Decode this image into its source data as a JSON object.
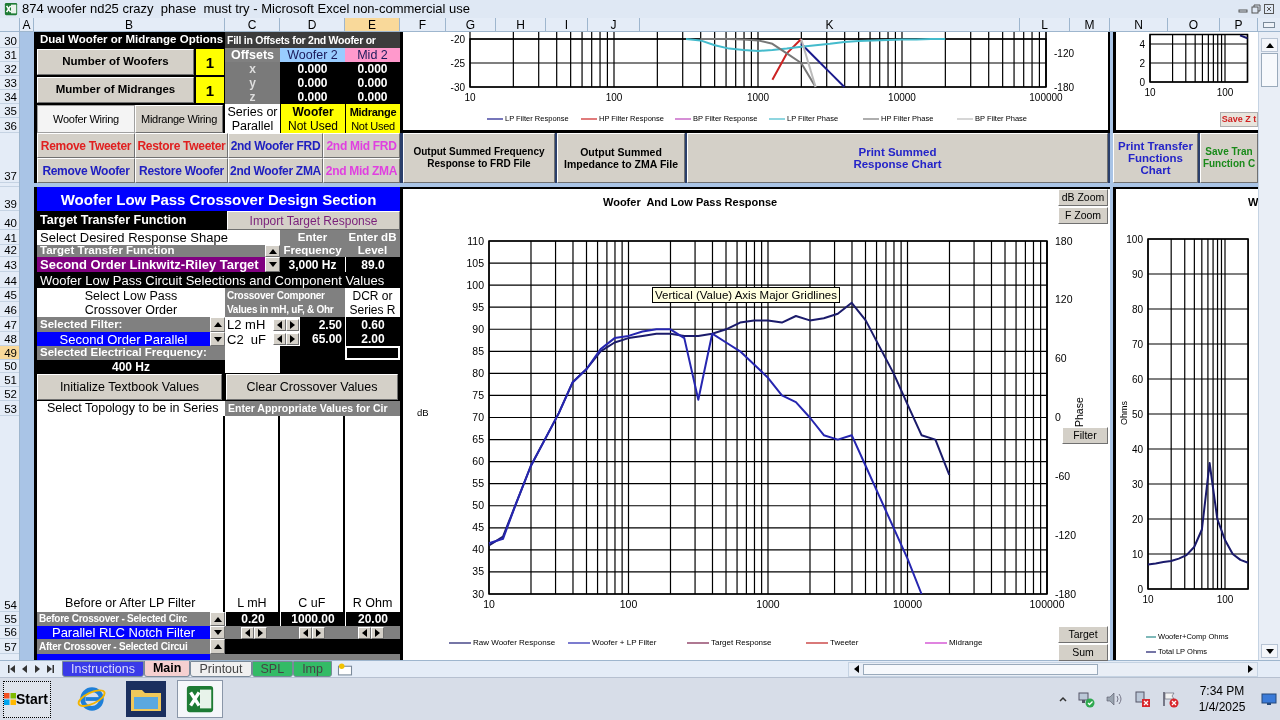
{
  "window": {
    "title": "874 woofer nd25 crazy  phase  must try - Microsoft Excel non-commercial use"
  },
  "column_headers": [
    {
      "label": "A",
      "selected": false
    },
    {
      "label": "B",
      "selected": false
    },
    {
      "label": "C",
      "selected": false
    },
    {
      "label": "D",
      "selected": false
    },
    {
      "label": "E",
      "selected": true
    },
    {
      "label": "F",
      "selected": false
    },
    {
      "label": "G",
      "selected": false
    },
    {
      "label": "H",
      "selected": false
    },
    {
      "label": "I",
      "selected": false
    },
    {
      "label": "J",
      "selected": false
    },
    {
      "label": "K",
      "selected": false
    },
    {
      "label": "L",
      "selected": false
    },
    {
      "label": "M",
      "selected": false
    },
    {
      "label": "N",
      "selected": false
    },
    {
      "label": "O",
      "selected": false
    },
    {
      "label": "P",
      "selected": false
    }
  ],
  "row_headers": [
    {
      "label": "30",
      "selected": false
    },
    {
      "label": "31",
      "selected": false
    },
    {
      "label": "32",
      "selected": false
    },
    {
      "label": "33",
      "selected": false
    },
    {
      "label": "34",
      "selected": false
    },
    {
      "label": "35",
      "selected": false
    },
    {
      "label": "36",
      "selected": false
    },
    {
      "label": "37",
      "selected": false
    },
    {
      "label": "39",
      "selected": false
    },
    {
      "label": "40",
      "selected": false
    },
    {
      "label": "41",
      "selected": false
    },
    {
      "label": "42",
      "selected": false
    },
    {
      "label": "43",
      "selected": false
    },
    {
      "label": "44",
      "selected": false
    },
    {
      "label": "45",
      "selected": false
    },
    {
      "label": "46",
      "selected": false
    },
    {
      "label": "47",
      "selected": false
    },
    {
      "label": "48",
      "selected": false
    },
    {
      "label": "49",
      "selected": true
    },
    {
      "label": "50",
      "selected": false
    },
    {
      "label": "51",
      "selected": false
    },
    {
      "label": "52",
      "selected": false
    },
    {
      "label": "53",
      "selected": false
    },
    {
      "label": "54",
      "selected": false
    },
    {
      "label": "55",
      "selected": false
    },
    {
      "label": "56",
      "selected": false
    },
    {
      "label": "57",
      "selected": false
    }
  ],
  "dual_options": {
    "title": "Dual Woofer or Midrange Options",
    "woofer_button": "Number of Woofers",
    "woofer_count": "1",
    "midrange_button": "Mumber of Midranges",
    "midrange_count": "1",
    "wiring_tabs": [
      {
        "label": "Woofer Wiring",
        "selected": true
      },
      {
        "label": "Midrange Wiring",
        "selected": false
      }
    ]
  },
  "offsets": {
    "title": "Fill in Offsets for 2nd Woofer or",
    "headers": [
      "Offsets",
      "Woofer 2",
      "Mid 2"
    ],
    "rows": [
      {
        "axis": "x",
        "woofer_2": "0.000",
        "mid_2": "0.000"
      },
      {
        "axis": "y",
        "woofer_2": "0.000",
        "mid_2": "0.000"
      },
      {
        "axis": "z",
        "woofer_2": "0.000",
        "mid_2": "0.000"
      }
    ],
    "wiring_label": [
      "Series or",
      "Parallel"
    ],
    "woofer_wiring": [
      "Woofer",
      "Not Used"
    ],
    "midrange_wiring": [
      "Midrange",
      "Not Used"
    ]
  },
  "tool_buttons": [
    {
      "label": "Remove Tweeter",
      "color": "#e02020"
    },
    {
      "label": "Restore Tweeter",
      "color": "#e02020"
    },
    {
      "label": "2nd Woofer FRD",
      "color": "#2020c0"
    },
    {
      "label": "2nd Mid FRD",
      "color": "#e040e0"
    },
    {
      "label": "Remove Woofer",
      "color": "#2020c0"
    },
    {
      "label": "Restore Woofer",
      "color": "#2020c0"
    },
    {
      "label": "2nd Woofer ZMA",
      "color": "#2020c0"
    },
    {
      "label": "2nd Mid ZMA",
      "color": "#e040e0"
    }
  ],
  "crossover": {
    "title": "Woofer Low Pass Crossover Design Section",
    "target_label": "Target Transfer Function",
    "import_button": "Import Target Response",
    "shape_label": "Select Desired Response Shape",
    "frequency_header": [
      "Enter",
      "Frequency"
    ],
    "level_header": [
      "Enter dB",
      "Level"
    ],
    "function_label": "Target Transfer Function",
    "function_value": "Second Order Linkwitz-Riley Target",
    "target_frequency": "3,000 Hz",
    "target_level": "89.0",
    "circuit_title": "Woofer Low Pass Circuit Selections and Component Values",
    "order_header": [
      "Select Low Pass",
      "Crossover Order"
    ],
    "component_header": [
      "Crossover Componer",
      "Values in mH, uF, & Ohr"
    ],
    "dcr_header": [
      "DCR or",
      "Series R"
    ],
    "filter_label": "Selected Filter:",
    "filter_value": "Second Order Parallel",
    "components": [
      {
        "name": "L2 mH",
        "value": "2.50",
        "dcr": "0.60"
      },
      {
        "name": "C2  uF",
        "value": "65.00",
        "dcr": "2.00"
      }
    ],
    "frequency_label": "Selected Electrical Frequency:",
    "frequency_value": "400 Hz",
    "buttons": [
      "Initialize Textbook Values",
      "Clear Crossover Values"
    ]
  },
  "topology": {
    "title": "Select Topology to be in Series",
    "values_title": "Enter Appropriate Values for Cir",
    "columns": [
      "Before or After LP Filter",
      "L mH",
      "C uF",
      "R Ohm"
    ],
    "before_label": "Before Crossover - Selected Circ",
    "before_value": "Parallel RLC Notch Filter",
    "before_values": [
      "0.20",
      "1000.00",
      "20.00"
    ],
    "after_label": "After Crossover - Selected Circui"
  },
  "top_chart": {
    "chart_data": {
      "type": "line",
      "grid": true,
      "legend": "bottom",
      "ylim": [
        -30,
        -20
      ],
      "yticks": [
        -30,
        -25,
        -20
      ],
      "y2lim": [
        -180,
        -93
      ],
      "y2ticks": [
        -180,
        -120
      ],
      "categories": [
        "10",
        null,
        null,
        null,
        null,
        null,
        null,
        null,
        null,
        null,
        "100",
        null,
        null,
        null,
        null,
        null,
        null,
        null,
        null,
        null,
        "1000",
        null,
        null,
        null,
        null,
        null,
        null,
        null,
        null,
        null,
        "10000",
        null,
        null,
        null,
        null,
        null,
        null,
        null,
        null,
        null,
        "100000"
      ],
      "series": [
        {
          "name": "LP Filter Response",
          "color": "#1a1a8c",
          "values": [
            null,
            null,
            null,
            null,
            null,
            null,
            null,
            null,
            null,
            null,
            null,
            null,
            null,
            null,
            null,
            null,
            null,
            null,
            null,
            null,
            null,
            null,
            null,
            -21,
            -24,
            -27,
            -30,
            null,
            null,
            null,
            null,
            null,
            null,
            null,
            null,
            null,
            null,
            null,
            null,
            null,
            null
          ]
        },
        {
          "name": "HP Filter Response",
          "color": "#cc2222",
          "values": [
            null,
            null,
            null,
            null,
            null,
            null,
            null,
            null,
            null,
            null,
            null,
            null,
            null,
            null,
            null,
            null,
            null,
            null,
            null,
            null,
            null,
            -28.5,
            -23,
            -20,
            null,
            null,
            null,
            null,
            null,
            null,
            null,
            null,
            null,
            null,
            null,
            null,
            null,
            null,
            null,
            null,
            null
          ]
        },
        {
          "name": "BP Filter Response",
          "color": "#bb44bb",
          "values": [
            null,
            null,
            null,
            null,
            null,
            null,
            null,
            null,
            null,
            null,
            null,
            null,
            null,
            null,
            null,
            null,
            null,
            null,
            null,
            null,
            null,
            null,
            null,
            null,
            null,
            null,
            null,
            null,
            null,
            null,
            null,
            null,
            null,
            null,
            null,
            null,
            null,
            null,
            null,
            null,
            null
          ]
        },
        {
          "name": "LP Filter Phase",
          "color": "#44bbcc",
          "values": [
            null,
            null,
            null,
            null,
            null,
            null,
            null,
            null,
            null,
            null,
            null,
            null,
            null,
            null,
            null,
            -20,
            -20.3,
            -21.3,
            -22,
            -22.3,
            -22.5,
            -22.3,
            -22,
            -21.6,
            -21.3,
            -21,
            -20.6,
            -20.4,
            -20.3,
            -20.2,
            -20.1,
            -20.1,
            -20,
            -20,
            null,
            null,
            null,
            null,
            null,
            null,
            null
          ]
        },
        {
          "name": "HP Filter Phase",
          "color": "#777777",
          "values": [
            null,
            null,
            null,
            null,
            null,
            null,
            null,
            null,
            null,
            null,
            null,
            null,
            null,
            null,
            null,
            null,
            -20,
            -20,
            -20,
            -20.1,
            -20.3,
            -21,
            -23,
            -25,
            -30,
            null,
            null,
            null,
            null,
            null,
            null,
            null,
            null,
            null,
            null,
            null,
            null,
            null,
            null,
            null,
            null
          ]
        },
        {
          "name": "BP Filter Phase",
          "color": "#bbbbbb",
          "values": [
            null,
            null,
            null,
            null,
            null,
            null,
            null,
            null,
            null,
            null,
            null,
            null,
            null,
            null,
            null,
            null,
            null,
            null,
            null,
            null,
            null,
            null,
            null,
            -20,
            -30,
            null,
            null,
            null,
            null,
            null,
            null,
            null,
            null,
            null,
            null,
            null,
            null,
            null,
            null,
            null,
            null
          ]
        }
      ]
    }
  },
  "summary_buttons": [
    {
      "label": "Output Summed Frequency Response to FRD File",
      "color": "#000000"
    },
    {
      "label": "Output Summed Impedance to ZMA File",
      "color": "#000000"
    },
    {
      "label": "Print Summed Response Chart",
      "color": "#2424c8"
    }
  ],
  "main_chart": {
    "chart_data": {
      "type": "line",
      "grid": true,
      "legend": "bottom",
      "title": "Woofer  And Low Pass Response",
      "ylabel": "dB",
      "y2label": "Phase",
      "ylim": [
        30,
        110
      ],
      "yticks": [
        30,
        35,
        40,
        45,
        50,
        55,
        60,
        65,
        70,
        75,
        80,
        85,
        90,
        95,
        100,
        105,
        110
      ],
      "y2lim": [
        -180,
        180
      ],
      "y2ticks": [
        -180,
        -120,
        -60,
        0,
        60,
        120,
        180
      ],
      "categories": [
        "10",
        null,
        null,
        null,
        null,
        null,
        null,
        null,
        null,
        null,
        "100",
        null,
        null,
        null,
        null,
        null,
        null,
        null,
        null,
        null,
        "1000",
        null,
        null,
        null,
        null,
        null,
        null,
        null,
        null,
        null,
        "10000",
        null,
        null,
        null,
        null,
        null,
        null,
        null,
        null,
        null,
        "100000"
      ],
      "series": [
        {
          "name": "Raw Woofer Response",
          "color": "#1b1b6b",
          "values": [
            41,
            43,
            51,
            59,
            65,
            71,
            78,
            81,
            85,
            87,
            88,
            88.5,
            89,
            89,
            88.5,
            88.5,
            89,
            90,
            91.5,
            92,
            92,
            91.5,
            93,
            92,
            92.5,
            93.5,
            96,
            92,
            86,
            80,
            73,
            66,
            65,
            57,
            null,
            null,
            null,
            null,
            null,
            null,
            null
          ]
        },
        {
          "name": "Woofer + LP Filter",
          "color": "#2626b0",
          "values": [
            41.5,
            42.5,
            51,
            59,
            65,
            71,
            78,
            81,
            85.5,
            88,
            88.5,
            89.5,
            90,
            90,
            88,
            74,
            89,
            87,
            85,
            82,
            79,
            75,
            73.5,
            70,
            66,
            65,
            66,
            59,
            52,
            45,
            38,
            30,
            null,
            null,
            null,
            null,
            null,
            null,
            null,
            null,
            null
          ]
        },
        {
          "name": "Target Response",
          "color": "#7a1f4a",
          "values": [
            null,
            null,
            null,
            null,
            null,
            null,
            null,
            null,
            null,
            null,
            null,
            null,
            null,
            null,
            null,
            null,
            null,
            null,
            null,
            null,
            null,
            null,
            null,
            null,
            null,
            null,
            null,
            null,
            null,
            null,
            null,
            null,
            null,
            null,
            null,
            null,
            null,
            null,
            null,
            null,
            null
          ]
        },
        {
          "name": "Tweeter",
          "color": "#c02020",
          "values": [
            null,
            null,
            null,
            null,
            null,
            null,
            null,
            null,
            null,
            null,
            null,
            null,
            null,
            null,
            null,
            null,
            null,
            null,
            null,
            null,
            null,
            null,
            null,
            null,
            null,
            null,
            null,
            null,
            null,
            null,
            null,
            null,
            null,
            null,
            null,
            null,
            null,
            null,
            null,
            null,
            null
          ]
        },
        {
          "name": "Midrange",
          "color": "#cc33cc",
          "values": [
            null,
            null,
            null,
            null,
            null,
            null,
            null,
            null,
            null,
            null,
            null,
            null,
            null,
            null,
            null,
            null,
            null,
            null,
            null,
            null,
            null,
            null,
            null,
            null,
            null,
            null,
            null,
            null,
            null,
            null,
            null,
            null,
            null,
            null,
            null,
            null,
            null,
            null,
            null,
            null,
            null
          ]
        }
      ]
    },
    "zoom_buttons": [
      "dB Zoom",
      "F Zoom"
    ],
    "filter_button": "Filter",
    "bottom_buttons": [
      "Target",
      "Sum"
    ],
    "tooltip": "Vertical (Value) Axis Major Gridlines"
  },
  "right_top_chart": {
    "chart_data": {
      "type": "line",
      "grid": true,
      "ylim": [
        0,
        5
      ],
      "yticks": [
        0,
        2,
        4
      ],
      "categories": [
        "10",
        null,
        null,
        null,
        null,
        null,
        null,
        null,
        null,
        null,
        "100",
        null,
        null,
        null
      ],
      "series": [
        {
          "color": "#1a1a6b",
          "values": [
            null,
            null,
            null,
            null,
            null,
            null,
            null,
            null,
            null,
            null,
            null,
            null,
            4.9,
            4.6
          ]
        }
      ]
    },
    "save_button": "Save Z t"
  },
  "right_buttons": [
    {
      "label": "Print Transfer Functions Chart",
      "color": "#2424c8"
    },
    {
      "label": "Save Tran Function C",
      "color": "#1a8a1a"
    }
  ],
  "impedance_chart": {
    "chart_data": {
      "type": "line",
      "grid": true,
      "legend": "bottom",
      "title": "W",
      "ylabel": "Ohms",
      "ylim": [
        0,
        100
      ],
      "yticks": [
        0,
        10,
        20,
        30,
        40,
        50,
        60,
        70,
        80,
        90,
        100
      ],
      "categories": [
        "10",
        null,
        null,
        null,
        null,
        null,
        null,
        null,
        null,
        null,
        "100",
        null,
        null,
        null
      ],
      "series": [
        {
          "name": "Woofer+Comp Ohms",
          "color": "#2a8a8a",
          "values": [
            null,
            null,
            null,
            null,
            null,
            null,
            null,
            null,
            null,
            null,
            null,
            null,
            null,
            null
          ]
        },
        {
          "name": "Total LP Ohms",
          "color": "#1a1a6b",
          "values": [
            7,
            7.3,
            7.7,
            8,
            8.7,
            9.7,
            12,
            17,
            36,
            20,
            14,
            10,
            8.3,
            7.5
          ]
        }
      ]
    }
  },
  "sheet_tabs": [
    {
      "label": "Instructions",
      "color": "#3a3ae8",
      "selected": false
    },
    {
      "label": "Main",
      "color": "#f6d0d0",
      "selected": true
    },
    {
      "label": "Printout",
      "color": "#f0f0f0",
      "selected": false
    },
    {
      "label": "SPL",
      "color": "#33bb66",
      "selected": false
    },
    {
      "label": "Imp",
      "color": "#33bb66",
      "selected": false
    }
  ],
  "taskbar": {
    "start": "Start",
    "apps": [
      {
        "kind": "browser",
        "selected": false
      },
      {
        "kind": "folder",
        "selected": false
      },
      {
        "kind": "spreadsheet",
        "selected": true
      }
    ],
    "time": "7:34 PM",
    "date": "1/4/2025"
  }
}
